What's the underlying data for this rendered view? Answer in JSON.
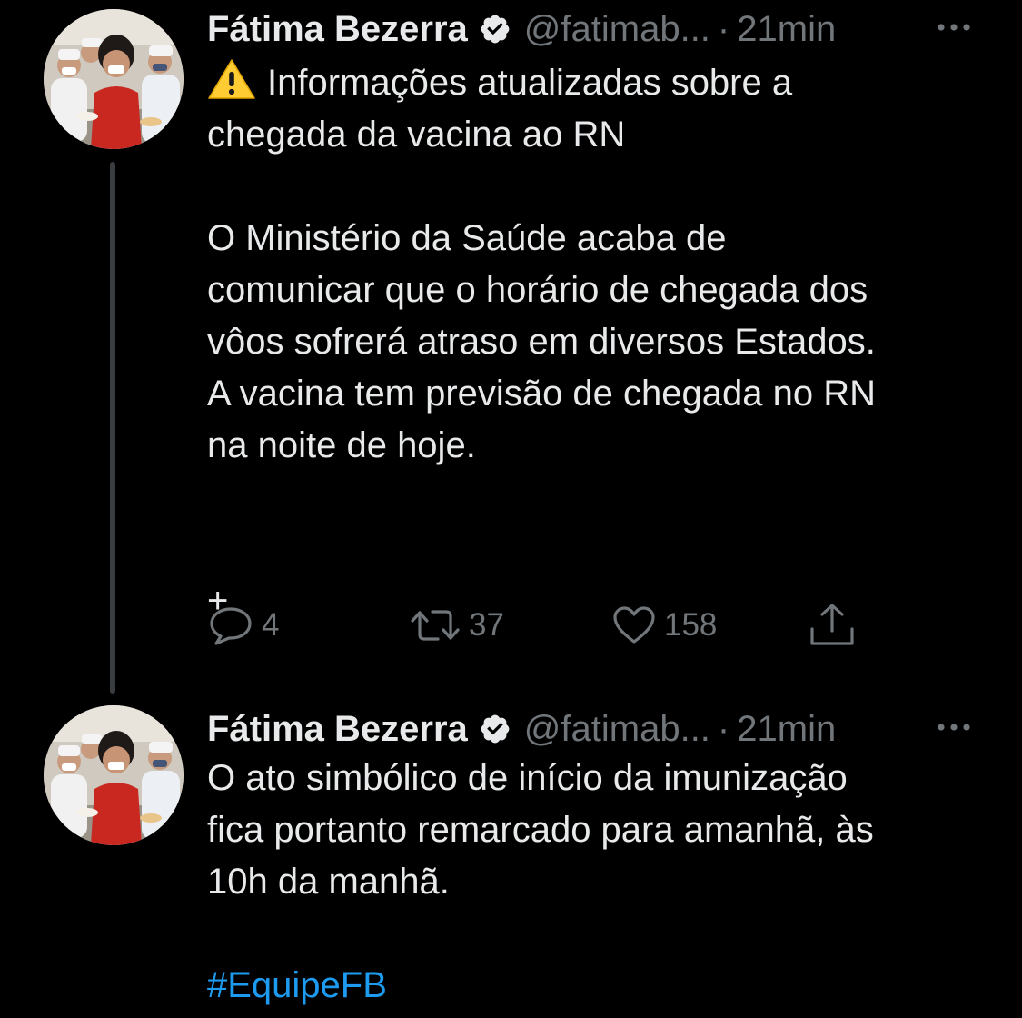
{
  "colors": {
    "background": "#000000",
    "text": "#e7e9ea",
    "muted": "#71767b",
    "link": "#1d9bf0",
    "thread_line": "#3a3d40"
  },
  "tweets": [
    {
      "author": "Fátima Bezerra",
      "handle": "@fatimab...",
      "separator": "·",
      "time": "21min",
      "icons": [
        "verified-badge-icon",
        "more-options-icon",
        "warning-sign-icon"
      ],
      "text_line1": "Informações atualizadas sobre a\nchegada da vacina ao RN",
      "text_main": "\n\nO Ministério da Saúde acaba de\ncomunicar que o horário de chegada dos\nvôos sofrerá atraso em diversos Estados.\nA vacina tem previsão de chegada no RN\nna noite de hoje.\n\n\n+",
      "actions": {
        "reply_count": "4",
        "retweet_count": "37",
        "like_count": "158"
      }
    },
    {
      "author": "Fátima Bezerra",
      "handle": "@fatimab...",
      "separator": "·",
      "time": "21min",
      "text": "O ato simbólico de início da imunização\nfica portanto remarcado para amanhã, às\n10h da manhã.\n\n",
      "hashtag": "#EquipeFB"
    }
  ]
}
